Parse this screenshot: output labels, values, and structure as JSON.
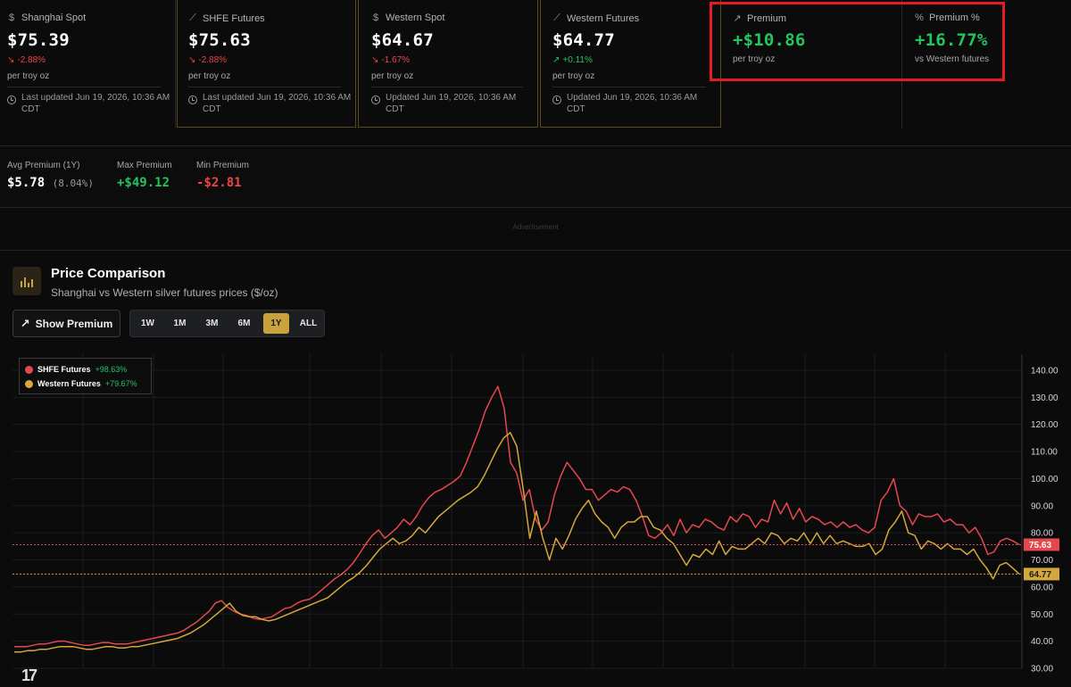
{
  "cards": [
    {
      "title": "Shanghai Spot",
      "icon": "dollar-icon",
      "value": "$75.39",
      "change": "-2.88%",
      "direction": "down",
      "unit": "per troy oz",
      "updated": "Last updated Jun 19, 2026, 10:36 AM CDT"
    },
    {
      "title": "SHFE Futures",
      "icon": "chart-line-icon",
      "value": "$75.63",
      "change": "-2.88%",
      "direction": "down",
      "unit": "per troy oz",
      "updated": "Last updated Jun 19, 2026, 10:36 AM CDT"
    },
    {
      "title": "Western Spot",
      "icon": "dollar-icon",
      "value": "$64.67",
      "change": "-1.67%",
      "direction": "down",
      "unit": "per troy oz",
      "updated": "Updated Jun 19, 2026, 10:36 AM CDT"
    },
    {
      "title": "Western Futures",
      "icon": "chart-line-icon",
      "value": "$64.77",
      "change": "+0.11%",
      "direction": "up",
      "unit": "per troy oz",
      "updated": "Updated Jun 19, 2026, 10:36 AM CDT"
    },
    {
      "title": "Premium",
      "icon": "trend-up-icon",
      "value": "+$10.86",
      "unit": "per troy oz"
    },
    {
      "title": "Premium %",
      "icon": "percent-icon",
      "value": "+16.77%",
      "unit": "vs Western futures"
    }
  ],
  "summary": {
    "avg_label": "Avg Premium (1Y)",
    "avg_value": "$5.78",
    "avg_pct": "(8.04%)",
    "max_label": "Max Premium",
    "max_value": "+$49.12",
    "min_label": "Min Premium",
    "min_value": "-$2.81"
  },
  "ad_label": "Advertisement",
  "panel": {
    "title": "Price Comparison",
    "subtitle": "Shanghai vs Western silver futures prices ($/oz)",
    "show_premium_label": "Show Premium",
    "ranges": [
      "1W",
      "1M",
      "3M",
      "6M",
      "1Y",
      "ALL"
    ],
    "active_range": "1Y"
  },
  "colors": {
    "shfe": "#e5484d",
    "western": "#d4a83a",
    "positive": "#22c55e",
    "negative": "#ef4444",
    "accent": "#c9a23c"
  },
  "chart_data": {
    "type": "line",
    "y_ticks": [
      "140.00",
      "130.00",
      "120.00",
      "110.00",
      "100.00",
      "90.00",
      "80.00",
      "70.00",
      "60.00",
      "50.00",
      "40.00",
      "30.00"
    ],
    "ylim": [
      30,
      140
    ],
    "legend_position": "top-left",
    "grid": true,
    "last_labels": {
      "shfe": "75.63",
      "western": "64.77"
    },
    "series": [
      {
        "name": "SHFE Futures",
        "change": "+98.63%",
        "color": "#e5484d",
        "values": [
          38,
          38,
          38,
          38.5,
          39,
          39,
          39.5,
          40,
          40,
          39.5,
          39,
          38.5,
          38.5,
          39,
          39.5,
          39.5,
          39,
          39,
          39,
          39.5,
          40,
          40.5,
          41,
          41.5,
          42,
          42.5,
          43,
          44,
          45.5,
          47,
          49,
          51,
          54,
          55,
          52.5,
          51,
          50,
          49.5,
          48.5,
          48,
          48.5,
          49,
          50.5,
          52,
          52.5,
          54,
          55,
          55.5,
          57,
          59,
          61,
          63,
          64.5,
          66.5,
          69,
          72.5,
          76,
          79,
          81,
          78,
          80,
          82,
          85,
          83,
          86,
          90,
          93,
          95,
          96,
          97.5,
          99,
          101,
          106,
          112,
          118,
          125,
          130,
          134,
          126,
          106,
          102,
          92,
          96,
          85,
          81,
          84,
          94,
          101,
          106,
          103,
          100,
          96,
          96,
          92,
          94,
          96,
          95,
          97,
          96,
          92,
          86,
          79,
          78,
          80,
          83,
          79,
          85,
          80,
          83,
          82,
          85,
          84,
          82,
          81,
          86,
          84,
          87,
          86,
          82,
          85,
          84,
          92,
          87,
          91,
          85,
          89,
          84,
          86,
          85,
          83,
          84,
          82,
          84,
          82,
          83,
          81,
          80,
          82,
          92,
          95,
          100,
          90,
          88,
          83,
          87,
          86,
          86,
          87,
          84,
          85,
          83,
          83,
          80,
          82,
          78,
          72,
          73,
          77,
          78,
          77,
          75.63
        ]
      },
      {
        "name": "Western Futures",
        "change": "+79.67%",
        "color": "#d4a83a",
        "values": [
          36,
          36,
          36.5,
          36.5,
          37,
          37,
          37.5,
          38,
          38,
          38,
          37.5,
          37,
          37,
          37.5,
          38,
          38,
          37.5,
          37.5,
          38,
          38,
          38.5,
          39,
          39.5,
          40,
          40.5,
          41,
          42,
          43,
          44.5,
          46,
          48,
          50,
          52,
          54,
          51,
          49.5,
          49,
          49,
          48,
          47.5,
          48,
          49,
          50,
          51,
          52,
          53,
          54,
          55,
          56,
          58,
          60,
          62,
          63.5,
          65.5,
          68,
          71,
          74,
          76,
          78,
          76,
          77,
          79,
          82,
          80,
          83,
          86,
          88,
          90,
          92,
          93.5,
          95,
          97,
          101,
          106,
          111,
          115,
          117,
          112,
          96,
          78,
          88,
          78,
          70,
          78,
          74,
          79,
          85,
          89,
          92,
          87,
          84,
          82,
          78,
          82,
          84,
          84,
          86,
          86,
          82,
          81,
          78,
          76,
          72,
          68,
          72,
          71,
          74,
          72,
          77,
          72,
          75,
          74,
          74,
          76,
          78,
          76,
          80,
          79,
          76,
          78,
          77,
          80,
          76,
          80,
          76,
          79,
          76,
          77,
          76,
          75,
          75,
          76,
          72,
          74,
          81,
          84,
          88,
          80,
          79,
          74,
          77,
          76,
          74,
          76,
          74,
          74,
          72,
          74,
          70,
          67,
          63,
          68,
          69,
          67,
          64.77
        ]
      }
    ]
  }
}
